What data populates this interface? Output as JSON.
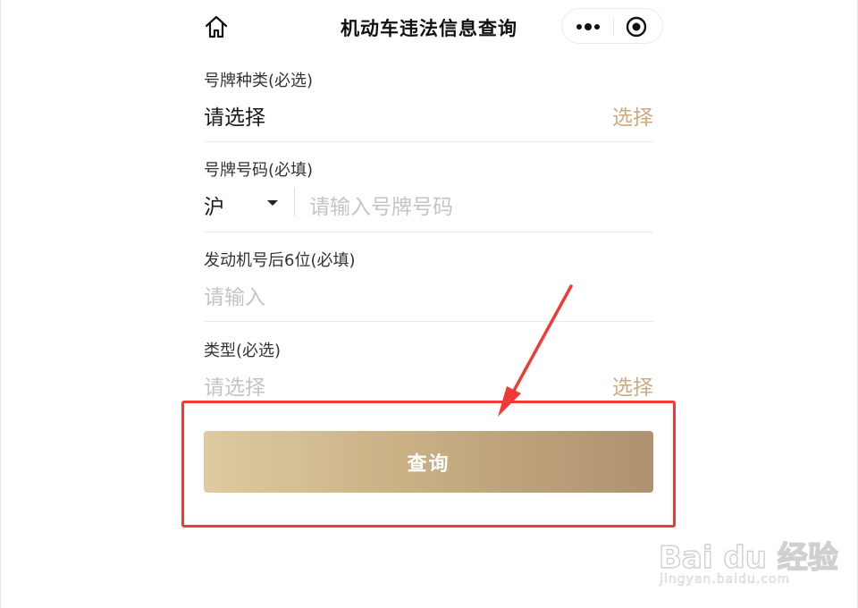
{
  "nav": {
    "title": "机动车违法信息查询",
    "home_icon": "home-icon",
    "more_icon": "more-dots-icon",
    "close_icon": "target-close-icon"
  },
  "form": {
    "plate_type": {
      "label": "号牌种类(必选)",
      "value": "请选择",
      "action": "选择"
    },
    "plate_number": {
      "label": "号牌号码(必填)",
      "province": "沪",
      "placeholder": "请输入号牌号码"
    },
    "engine_number": {
      "label": "发动机号后6位(必填)",
      "placeholder": "请输入"
    },
    "type": {
      "label": "类型(必选)",
      "placeholder": "请选择",
      "action": "选择"
    }
  },
  "submit": {
    "label": "查询"
  },
  "annotation": {
    "color": "#ef3a36"
  },
  "colors": {
    "accent": "#c9ad80",
    "button_start": "#decba0",
    "button_end": "#ae9270"
  },
  "watermark": {
    "logo": "Bai du 经验",
    "url": "jingyan.baidu.com"
  }
}
